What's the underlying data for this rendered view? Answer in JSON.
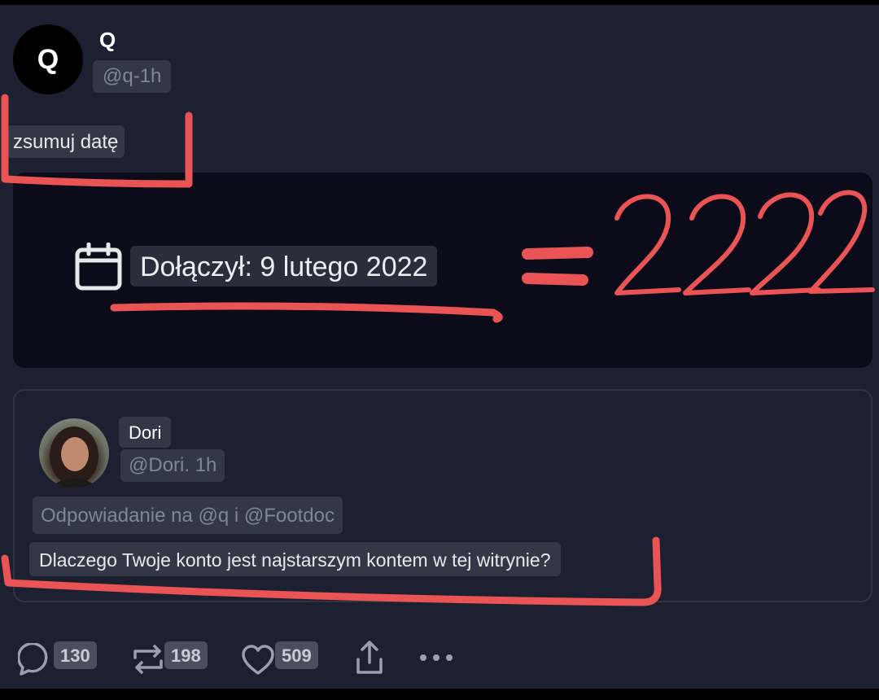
{
  "author": {
    "name": "Q",
    "handle": "@q-1h",
    "avatar_letter": "Q"
  },
  "tweet": {
    "text": "zsumuj datę"
  },
  "card": {
    "icon": "calendar-icon",
    "joined_text": "Dołączył: 9 lutego 2022"
  },
  "quoted": {
    "name": "Dori",
    "handle": "@Dori. 1h",
    "replying_to": "Odpowiadanie na @q i @Footdoc",
    "text": "Dlaczego Twoje konto jest najstarszym kontem w tej witrynie?"
  },
  "actions": {
    "reply_count": "130",
    "retweet_count": "198",
    "like_count": "509",
    "icons": [
      "reply-icon",
      "retweet-icon",
      "like-icon",
      "share-icon",
      "more-icon"
    ]
  },
  "annotation": {
    "equals_text": "=2222",
    "color": "#ea5455"
  },
  "colors": {
    "background": "#1c2030",
    "card": "#0c0b1a",
    "chip": "#333847",
    "muted_text": "#7f8699"
  }
}
